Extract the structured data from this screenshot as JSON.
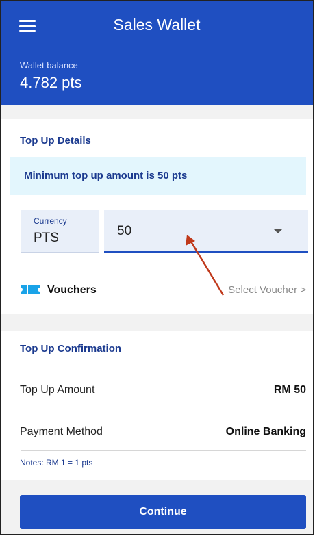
{
  "header": {
    "title": "Sales Wallet",
    "balance_label": "Wallet balance",
    "balance_value": "4.782 pts",
    "menu_icon": "hamburger-menu-icon"
  },
  "top_up_details": {
    "title": "Top Up Details",
    "info_message": "Minimum top up amount is 50 pts",
    "currency_label": "Currency",
    "currency_value": "PTS",
    "amount_value": "50",
    "vouchers_label": "Vouchers",
    "select_voucher": "Select Voucher >",
    "voucher_icon": "ticket-icon"
  },
  "top_up_confirmation": {
    "title": "Top Up Confirmation",
    "rows": [
      {
        "label": "Top Up Amount",
        "value": "RM 50"
      },
      {
        "label": "Payment Method",
        "value": "Online Banking"
      }
    ],
    "notes": "Notes: RM 1 = 1 pts"
  },
  "actions": {
    "continue_label": "Continue"
  },
  "colors": {
    "primary": "#1f4fc1",
    "info_bg": "#e3f6fd",
    "field_bg": "#e9eff9",
    "annotation_arrow": "#c0391b"
  }
}
